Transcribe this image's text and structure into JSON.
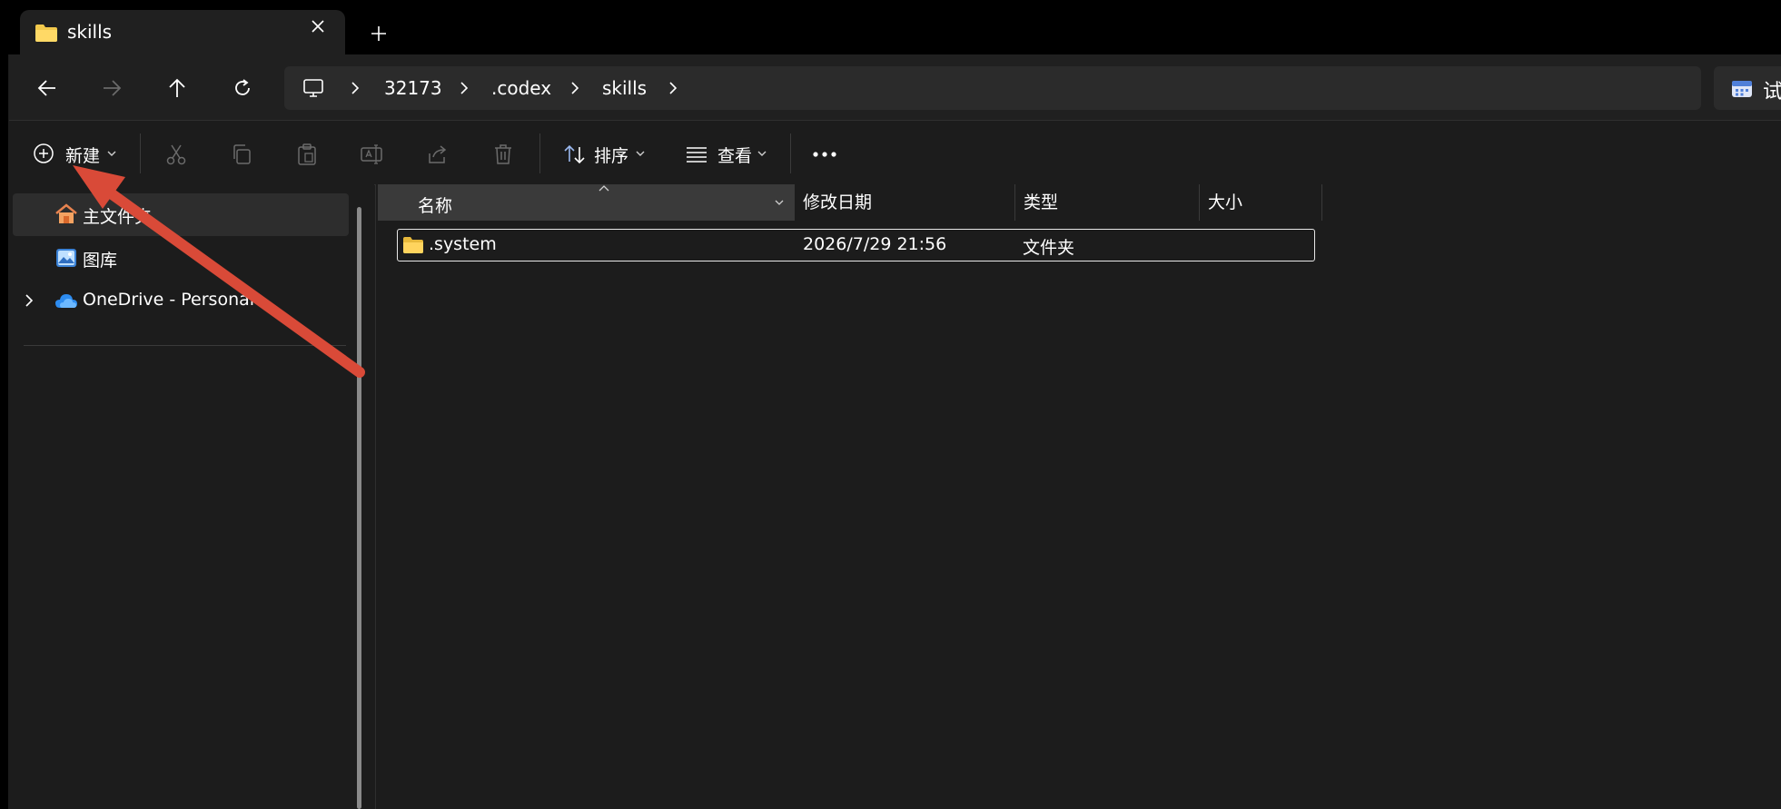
{
  "tab": {
    "title": "skills",
    "close_icon": "close-icon",
    "new_icon": "plus-icon"
  },
  "nav": {
    "back_icon": "arrow-left-icon",
    "forward_icon": "arrow-right-icon",
    "up_icon": "arrow-up-icon",
    "refresh_icon": "refresh-icon"
  },
  "address": {
    "root_icon": "monitor-icon",
    "crumbs": [
      "32173",
      ".codex",
      "skills"
    ]
  },
  "search": {
    "visible_text": "试"
  },
  "commands": {
    "new_label": "新建",
    "sort_label": "排序",
    "view_label": "查看",
    "icons": [
      "cut-icon",
      "copy-icon",
      "paste-icon",
      "rename-icon",
      "share-icon",
      "delete-icon"
    ]
  },
  "sidebar": {
    "items": [
      {
        "label": "主文件夹",
        "icon": "home-icon",
        "selected": true
      },
      {
        "label": "图库",
        "icon": "gallery-icon"
      },
      {
        "label": "OneDrive - Personal",
        "icon": "cloud-icon",
        "expandable": true
      }
    ]
  },
  "columns": {
    "name": "名称",
    "modified": "修改日期",
    "type": "类型",
    "size": "大小"
  },
  "files": [
    {
      "name": ".system",
      "modified": "2026/7/29 21:56",
      "type": "文件夹",
      "size": ""
    }
  ],
  "colors": {
    "accent_folder": "#f2c94c",
    "annotation_arrow": "#d94a38",
    "background": "#1c1c1c"
  }
}
